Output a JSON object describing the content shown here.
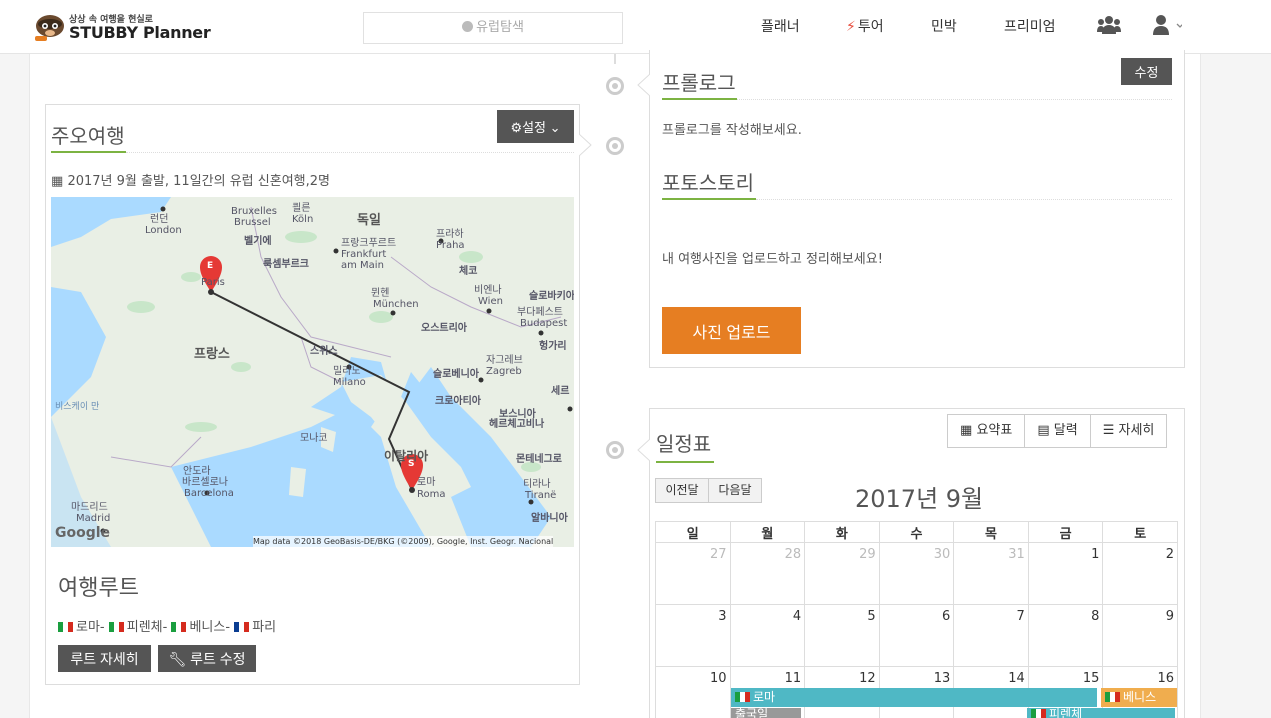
{
  "header": {
    "tagline": "상상 속 여행을 현실로",
    "brand": "STUBBY Planner",
    "search_placeholder": "유럽탐색",
    "nav": {
      "planner": "플래너",
      "tour": "투어",
      "minbak": "민박",
      "premium": "프리미엄"
    },
    "colors": {
      "tour_bolt": "#e74c3c"
    }
  },
  "trip": {
    "title": "주오여행",
    "settings_label": "설정",
    "summary": "2017년 9월 출발, 11일간의 유럽 신혼여행,2명",
    "map": {
      "attribution": "Map data ©2018 GeoBasis-DE/BKG (©2009), Google, Inst. Geogr. Nacional",
      "google": "Google",
      "markers": [
        "E",
        "S"
      ],
      "labels": {
        "london_ko": "런던",
        "london": "London",
        "brussels": "벨기에",
        "bruxelles": "Bruxelles",
        "brussel": "Brussel",
        "koln_ko": "쾰른",
        "koln": "Köln",
        "germany": "독일",
        "frankfurt_ko": "프랑크푸르트",
        "frankfurt": "Frankfurt",
        "frankfurt2": "am Main",
        "prague_ko": "프라하",
        "prague": "Praha",
        "czech": "체코",
        "luxembourg": "룩셈부르크",
        "paris": "Paris",
        "munich_ko": "뮌헨",
        "munich": "München",
        "vienna_ko": "비엔나",
        "vienna": "Wien",
        "slovakia": "슬로바키아",
        "budapest_ko": "부다페스트",
        "budapest": "Budapest",
        "austria": "오스트리아",
        "hungary": "헝가리",
        "france": "프랑스",
        "swiss": "스위스",
        "milan_ko": "밀라노",
        "milan": "Milano",
        "zagreb_ko": "자그레브",
        "zagreb": "Zagreb",
        "slovenia": "슬로베니아",
        "croatia": "크로아티아",
        "bih1": "보스니아",
        "bih2": "헤르체고비나",
        "serbia": "세르",
        "biscay": "비스케이 만",
        "monaco": "모나코",
        "italy": "이탈리아",
        "rome_ko": "로마",
        "rome": "Roma",
        "montenegro": "몬테네그로",
        "andorra_ko": "안도라",
        "barcelona_ko": "바르셀로나",
        "barcelona": "Barcelona",
        "madrid_ko": "마드리드",
        "madrid": "Madrid",
        "tirana_ko": "티라나",
        "tirana": "Tiranë",
        "albania": "알바니아"
      }
    },
    "route_title": "여행루트",
    "route": [
      "로마",
      "피렌체",
      "베니스",
      "파리"
    ],
    "route_detail_btn": "루트 자세히",
    "route_edit_btn": "루트 수정"
  },
  "prologue": {
    "edit_btn": "수정",
    "title": "프롤로그",
    "placeholder": "프롤로그를 작성해보세요.",
    "photo_title": "포토스토리",
    "photo_text": "내 여행사진을 업로드하고 정리해보세요!",
    "upload_btn": "사진 업로드",
    "upload_color": "#e67e22"
  },
  "schedule": {
    "title": "일정표",
    "tabs": [
      "요약표",
      "달력",
      "자세히"
    ],
    "prev_month": "이전달",
    "next_month": "다음달",
    "month_title": "2017년 9월",
    "weekdays": [
      "일",
      "월",
      "화",
      "수",
      "목",
      "금",
      "토"
    ],
    "weeks": [
      [
        "27",
        "28",
        "29",
        "30",
        "31",
        "1",
        "2"
      ],
      [
        "3",
        "4",
        "5",
        "6",
        "7",
        "8",
        "9"
      ],
      [
        "10",
        "11",
        "12",
        "13",
        "14",
        "15",
        "16"
      ]
    ],
    "events": [
      {
        "label": "로마",
        "color": "#4fb8c5"
      },
      {
        "label": "베니스",
        "color": "#f0ad4e"
      },
      {
        "label": "출국일",
        "color": "#999999"
      },
      {
        "label": "피렌체",
        "color": "#4fb8c5"
      }
    ]
  }
}
